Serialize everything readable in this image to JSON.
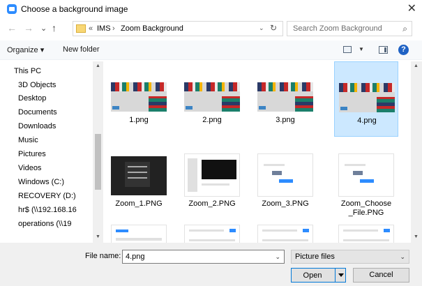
{
  "window": {
    "title": "Choose a background image",
    "close_glyph": "✕"
  },
  "nav": {
    "back": "←",
    "forward": "→",
    "recent": "⌄",
    "up": "↑"
  },
  "address": {
    "overflow": "«",
    "crumbs": [
      "IMS",
      "Zoom Background"
    ],
    "separator": "›",
    "dropdown": "⌄",
    "refresh": "↻"
  },
  "search": {
    "placeholder": "Search Zoom Background",
    "icon": "⌕"
  },
  "toolbar": {
    "organize": "Organize ▾",
    "new_folder": "New folder",
    "help": "?"
  },
  "tree": [
    {
      "label": "This PC",
      "icon": "pc-icon",
      "color": "#2c7fd6"
    },
    {
      "label": "3D Objects",
      "icon": "3d-objects-icon",
      "color": "#3aa0e0"
    },
    {
      "label": "Desktop",
      "icon": "desktop-icon",
      "color": "#1976d2"
    },
    {
      "label": "Documents",
      "icon": "documents-icon",
      "color": "#8d9aa8"
    },
    {
      "label": "Downloads",
      "icon": "downloads-icon",
      "color": "#1e6fd9"
    },
    {
      "label": "Music",
      "icon": "music-icon",
      "color": "#1e6fd9"
    },
    {
      "label": "Pictures",
      "icon": "pictures-icon",
      "color": "#6aa3d8"
    },
    {
      "label": "Videos",
      "icon": "videos-icon",
      "color": "#555a66"
    },
    {
      "label": "Windows (C:)",
      "icon": "drive-icon",
      "color": "#5a6b80"
    },
    {
      "label": "RECOVERY (D:)",
      "icon": "drive-icon",
      "color": "#707070"
    },
    {
      "label": "hr$ (\\\\192.168.16",
      "icon": "network-drive-icon",
      "color": "#c62828"
    },
    {
      "label": "operations (\\\\19",
      "icon": "network-drive-icon",
      "color": "#2e7d32"
    }
  ],
  "files": [
    {
      "name": "1.png",
      "kind": "background"
    },
    {
      "name": "2.png",
      "kind": "background"
    },
    {
      "name": "3.png",
      "kind": "background"
    },
    {
      "name": "4.png",
      "kind": "background",
      "selected": true
    },
    {
      "name": "Zoom_1.PNG",
      "kind": "dark-menu"
    },
    {
      "name": "Zoom_2.PNG",
      "kind": "settings"
    },
    {
      "name": "Zoom_3.PNG",
      "kind": "dialog"
    },
    {
      "name": "Zoom_Choose_File.PNG",
      "kind": "dialog"
    },
    {
      "name": "",
      "kind": "zoom-app"
    },
    {
      "name": "",
      "kind": "toggle"
    },
    {
      "name": "",
      "kind": "toggle"
    },
    {
      "name": "",
      "kind": "toggle-list"
    }
  ],
  "file_name": {
    "label": "File name:",
    "value": "4.png",
    "dropdown": "⌄"
  },
  "file_type": {
    "value": "Picture files",
    "dropdown": "⌄"
  },
  "buttons": {
    "open": "Open",
    "cancel": "Cancel"
  },
  "scroll": {
    "up": "▲",
    "down": "▼"
  }
}
